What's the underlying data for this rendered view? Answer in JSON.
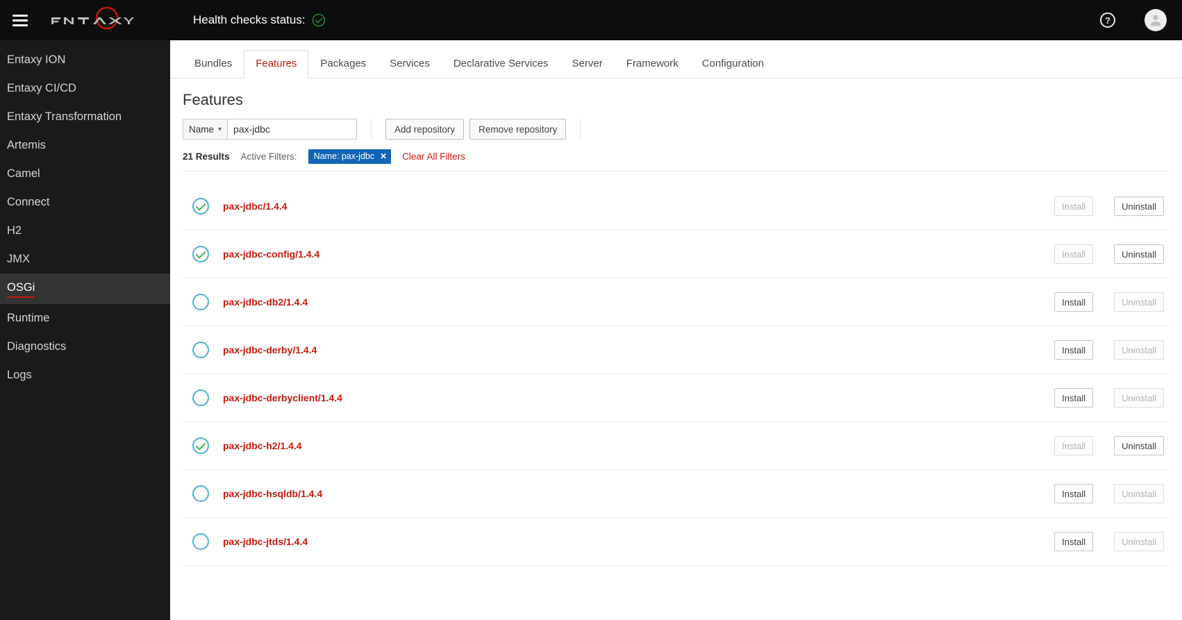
{
  "header": {
    "health_label": "Health checks status:",
    "logo_alt": "entaxy"
  },
  "sidebar": {
    "items": [
      {
        "label": "Entaxy ION",
        "active": false
      },
      {
        "label": "Entaxy CI/CD",
        "active": false
      },
      {
        "label": "Entaxy Transformation",
        "active": false
      },
      {
        "label": "Artemis",
        "active": false
      },
      {
        "label": "Camel",
        "active": false
      },
      {
        "label": "Connect",
        "active": false
      },
      {
        "label": "H2",
        "active": false
      },
      {
        "label": "JMX",
        "active": false
      },
      {
        "label": "OSGi",
        "active": true
      },
      {
        "label": "Runtime",
        "active": false
      },
      {
        "label": "Diagnostics",
        "active": false
      },
      {
        "label": "Logs",
        "active": false
      }
    ]
  },
  "tabs": [
    {
      "label": "Bundles",
      "active": false
    },
    {
      "label": "Features",
      "active": true
    },
    {
      "label": "Packages",
      "active": false
    },
    {
      "label": "Services",
      "active": false
    },
    {
      "label": "Declarative Services",
      "active": false
    },
    {
      "label": "Server",
      "active": false
    },
    {
      "label": "Framework",
      "active": false
    },
    {
      "label": "Configuration",
      "active": false
    }
  ],
  "page": {
    "title": "Features",
    "filter_attr_label": "Name",
    "filter_value": "pax-jdbc",
    "add_repo_label": "Add repository",
    "remove_repo_label": "Remove repository",
    "results_count_label": "21 Results",
    "active_filters_label": "Active Filters:",
    "filter_chip_label": "Name: pax-jdbc",
    "clear_filters_label": "Clear All Filters",
    "install_label": "Install",
    "uninstall_label": "Uninstall"
  },
  "features": [
    {
      "name": "pax-jdbc/1.4.4",
      "installed": true
    },
    {
      "name": "pax-jdbc-config/1.4.4",
      "installed": true
    },
    {
      "name": "pax-jdbc-db2/1.4.4",
      "installed": false
    },
    {
      "name": "pax-jdbc-derby/1.4.4",
      "installed": false
    },
    {
      "name": "pax-jdbc-derbyclient/1.4.4",
      "installed": false
    },
    {
      "name": "pax-jdbc-h2/1.4.4",
      "installed": true
    },
    {
      "name": "pax-jdbc-hsqldb/1.4.4",
      "installed": false
    },
    {
      "name": "pax-jdbc-jtds/1.4.4",
      "installed": false
    }
  ]
}
